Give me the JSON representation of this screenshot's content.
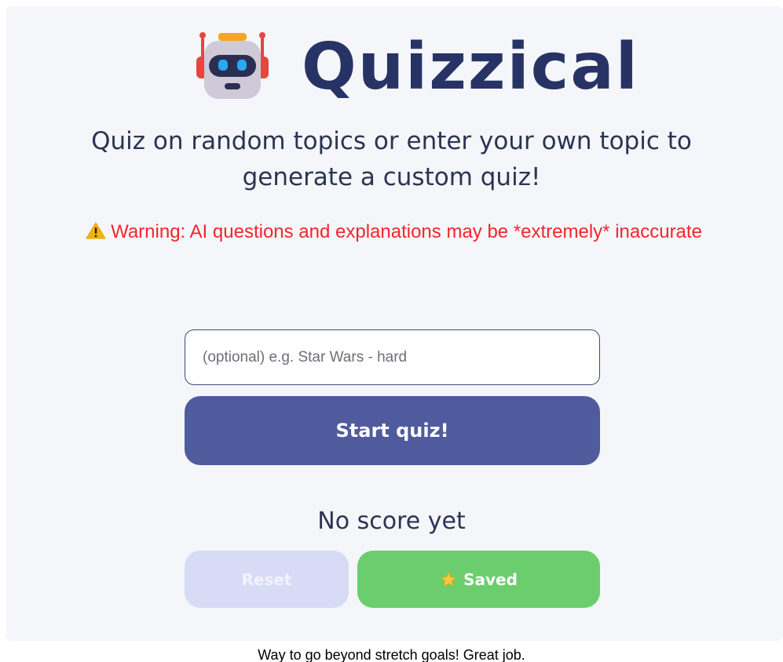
{
  "header": {
    "title": "Quizzical",
    "logo_icon": "robot-icon"
  },
  "intro": {
    "subtitle": "Quiz on random topics or enter your own topic to generate a custom quiz!"
  },
  "warning": {
    "icon": "warning-icon",
    "text": "Warning: AI questions and explanations may be *extremely* inaccurate"
  },
  "topic": {
    "placeholder": "(optional) e.g. Star Wars - hard",
    "value": ""
  },
  "actions": {
    "start_label": "Start quiz!",
    "reset_label": "Reset",
    "saved_label": "Saved",
    "saved_icon": "star-icon"
  },
  "score": {
    "text": "No score yet"
  },
  "footer": {
    "text": "Way to go beyond stretch goals! Great job."
  },
  "colors": {
    "title": "#283365",
    "warning": "#f2262b",
    "primary_button": "#4f5b9c",
    "reset_button_disabled": "#d8dbf5",
    "saved_button": "#6ccd6f",
    "card_background": "#f5f6fa"
  }
}
